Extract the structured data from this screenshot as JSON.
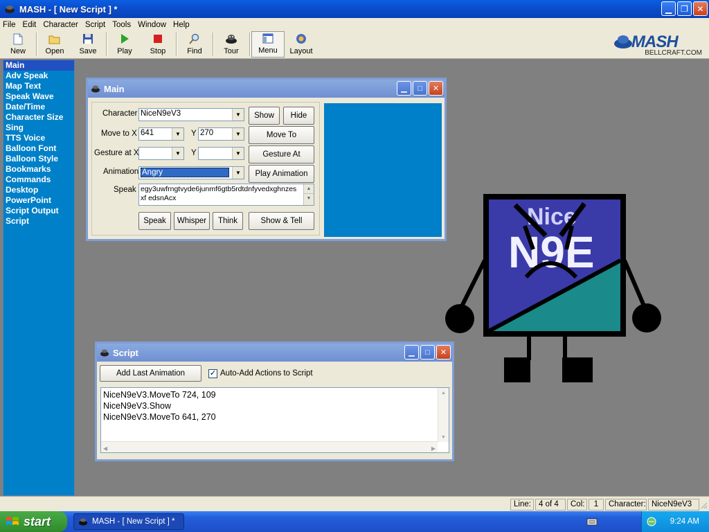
{
  "window": {
    "title": "MASH - [ New Script ] *"
  },
  "menu": [
    "File",
    "Edit",
    "Character",
    "Script",
    "Tools",
    "Window",
    "Help"
  ],
  "toolbar": [
    "New",
    "Open",
    "Save",
    "Play",
    "Stop",
    "Find",
    "Tour",
    "Menu",
    "Layout"
  ],
  "logo": {
    "word": "MASH",
    "sub": "BELLCRAFT.COM"
  },
  "sidebar": [
    "Main",
    "Adv Speak",
    "Map Text",
    "Speak Wave",
    "Date/Time",
    "Character Size",
    "Sing",
    "TTS Voice",
    "Balloon Font",
    "Balloon Style",
    "Bookmarks",
    "Commands",
    "Desktop",
    "PowerPoint",
    "Script Output",
    "Script"
  ],
  "main_window": {
    "title": "Main",
    "character_label": "Character",
    "character_value": "NiceN9eV3",
    "show_label": "Show",
    "hide_label": "Hide",
    "move_to_label": "Move to X",
    "move_x": "641",
    "y_label": "Y",
    "move_y": "270",
    "move_to_button": "Move To",
    "gesture_label": "Gesture at X",
    "gesture_x": "",
    "gesture_y": "",
    "gesture_button": "Gesture At",
    "animation_label": "Animation",
    "animation_value": "Angry",
    "play_animation_button": "Play Animation",
    "speak_label": "Speak",
    "speak_text": "egy3uwfrngtvyde6junmf6gtb5rdtdnfyvedxghnzes xf edsnAcx",
    "speak_button": "Speak",
    "whisper_button": "Whisper",
    "think_button": "Think",
    "show_tell_button": "Show & Tell"
  },
  "script_window": {
    "title": "Script",
    "add_last_animation": "Add Last Animation",
    "auto_add_label": "Auto-Add Actions to Script",
    "auto_add_checked": true,
    "lines": [
      "NiceN9eV3.MoveTo 724, 109",
      "NiceN9eV3.Show",
      "NiceN9eV3.MoveTo 641, 270"
    ]
  },
  "character_sprite": {
    "text_top": "Nice",
    "text_main": "N9E",
    "colors": {
      "body": "#3a3aa8",
      "accent": "#1a8a8a"
    }
  },
  "status": {
    "line_label": "Line:",
    "line_value": "4 of 4",
    "col_label": "Col:",
    "col_value": "1",
    "character_label": "Character:",
    "character_value": "NiceN9eV3"
  },
  "taskbar": {
    "start": "start",
    "task": "MASH - [ New Script ] *",
    "clock": "9:24 AM"
  }
}
